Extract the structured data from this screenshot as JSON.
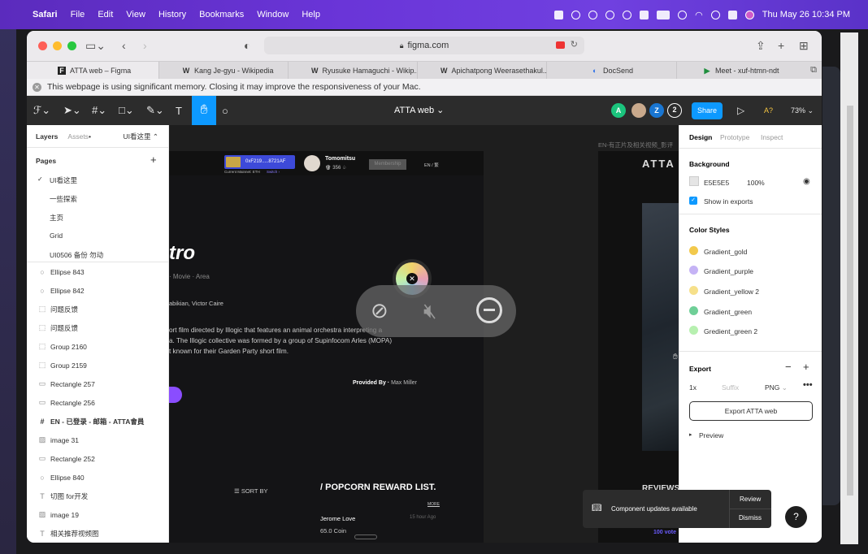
{
  "menubar": {
    "app": "Safari",
    "items": [
      "File",
      "Edit",
      "View",
      "History",
      "Bookmarks",
      "Window",
      "Help"
    ],
    "datetime": "Thu May 26  10:34 PM"
  },
  "browser": {
    "url": "figma.com",
    "tabs": [
      {
        "label": "ATTA web – Figma",
        "icon": "figma"
      },
      {
        "label": "Kang Je-gyu - Wikipedia",
        "icon": "W"
      },
      {
        "label": "Ryusuke Hamaguchi - Wikip...",
        "icon": "W"
      },
      {
        "label": "Apichatpong Weerasethakul...",
        "icon": "W"
      },
      {
        "label": "DocSend",
        "icon": "docsend"
      },
      {
        "label": "Meet - xuf-htmn-ndt",
        "icon": "meet"
      }
    ],
    "memory_banner": "This webpage is using significant memory. Closing it may improve the responsiveness of your Mac."
  },
  "figma": {
    "file_name": "ATTA web",
    "zoom": "73%",
    "share_label": "Share",
    "avatars": [
      "A",
      "Z"
    ],
    "avatar_count": "2",
    "aa": "A?"
  },
  "left_panel": {
    "tabs": [
      "Layers",
      "Assets"
    ],
    "page_selector": "UI看这里",
    "pages_heading": "Pages",
    "pages": [
      "UI看这里",
      "一些探索",
      "主页",
      "Grid",
      "UI0506 备份 勿动"
    ],
    "layers": [
      {
        "icon": "○",
        "label": "Ellipse 843"
      },
      {
        "icon": "○",
        "label": "Ellipse 842"
      },
      {
        "icon": "⬚",
        "label": "问题反馈"
      },
      {
        "icon": "⬚",
        "label": "问题反馈"
      },
      {
        "icon": "⬚",
        "label": "Group 2160"
      },
      {
        "icon": "⬚",
        "label": "Group 2159"
      },
      {
        "icon": "▭",
        "label": "Rectangle 257"
      },
      {
        "icon": "▭",
        "label": "Rectangle 256"
      },
      {
        "icon": "#",
        "label": "EN - 已登录 - 邮箱 - ATTA會員"
      },
      {
        "icon": "▨",
        "label": "image 31"
      },
      {
        "icon": "▭",
        "label": "Rectangle 252"
      },
      {
        "icon": "○",
        "label": "Ellipse 840"
      },
      {
        "icon": "T",
        "label": "切图 for开发"
      },
      {
        "icon": "▨",
        "label": "image 19"
      },
      {
        "icon": "T",
        "label": "相关推荐视频图"
      }
    ]
  },
  "canvas": {
    "frame2_label": "EN-有正片及相关视频_影评",
    "wallet_address": "0xF219.....8721AF",
    "wallet_sub": "Current Mainnet: ETH",
    "wallet_switch": "Switch ›",
    "user": "Tomomitsu",
    "user_stats": "356",
    "membership": "Membership",
    "lang": "EN / 繁",
    "title_partial": "tro",
    "genre": "· Movie · Area",
    "cast": "abikian, Victor Caire",
    "description": [
      "ort film directed by Illogic that features an animal orchestra interpreting a",
      "a. The Illogic collective was formed by a group of Supinfocom Arles (MOPA)",
      "t known for their Garden Party short film."
    ],
    "provided_by_label": "Provided By ·",
    "provided_by_name": "Max Miller",
    "sort_by": "SORT BY",
    "reward_title": "/ POPCORN REWARD LIST.",
    "more": "MORE",
    "reward_name": "Jerome Love",
    "reward_amount": "65.0 Coin",
    "reward_time": "15 hour Ago",
    "reviews": "REVIEWS",
    "votes": "100 vote",
    "atta_logo": "ATTA"
  },
  "right_panel": {
    "tabs": [
      "Design",
      "Prototype",
      "Inspect"
    ],
    "background_heading": "Background",
    "bg_hex": "E5E5E5",
    "bg_opacity": "100%",
    "show_in_exports": "Show in exports",
    "color_styles_heading": "Color Styles",
    "color_styles": [
      {
        "name": "Gradient_gold",
        "color": "#f2c94c"
      },
      {
        "name": "Gradient_purple",
        "color": "#c5b3f5"
      },
      {
        "name": "Gradient_yellow 2",
        "color": "#f6e08a"
      },
      {
        "name": "Gradient_green",
        "color": "#6fcf97"
      },
      {
        "name": "Gredient_green 2",
        "color": "#b7f0b0"
      }
    ],
    "export_heading": "Export",
    "export_scale": "1x",
    "export_suffix": "Suffix",
    "export_format": "PNG",
    "export_button": "Export ATTA web",
    "preview": "Preview"
  },
  "toast": {
    "message": "Component updates available",
    "review": "Review",
    "dismiss": "Dismiss"
  },
  "help": "?"
}
